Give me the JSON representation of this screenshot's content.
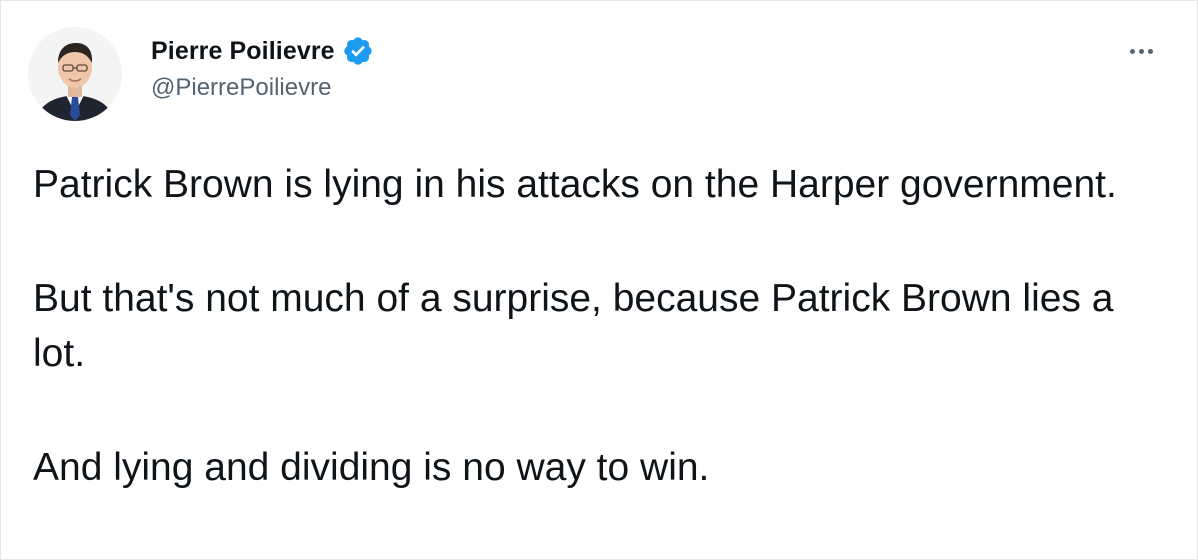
{
  "author": {
    "name": "Pierre Poilievre",
    "handle": "@PierrePoilievre",
    "verified": true
  },
  "icons": {
    "verified": "verified-badge-icon",
    "more": "more-options-icon"
  },
  "colors": {
    "text": "#0f1419",
    "secondary": "#536471",
    "verified_blue": "#1d9bf0"
  },
  "tweet": {
    "paragraphs": [
      "Patrick Brown is lying in his attacks on the Harper government.",
      "But that's not much of a surprise, because Patrick Brown lies a lot.",
      "And lying and dividing is no way to win."
    ]
  }
}
